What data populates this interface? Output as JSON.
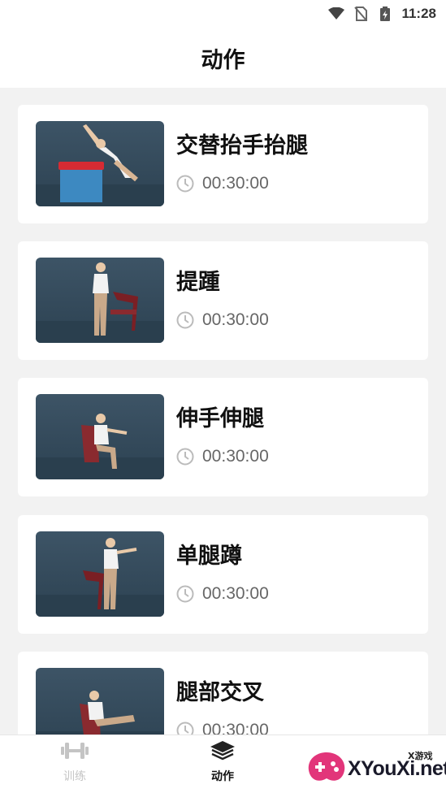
{
  "status_bar": {
    "time": "11:28",
    "icons": [
      "wifi-icon",
      "no-sim-icon",
      "battery-charging-icon"
    ]
  },
  "header": {
    "title": "动作"
  },
  "exercises": [
    {
      "title": "交替抬手抬腿",
      "duration": "00:30:00",
      "icon": "clock-icon"
    },
    {
      "title": "提踵",
      "duration": "00:30:00",
      "icon": "clock-icon"
    },
    {
      "title": "伸手伸腿",
      "duration": "00:30:00",
      "icon": "clock-icon"
    },
    {
      "title": "单腿蹲",
      "duration": "00:30:00",
      "icon": "clock-icon"
    },
    {
      "title": "腿部交叉",
      "duration": "00:30:00",
      "icon": "clock-icon"
    }
  ],
  "tabbar": {
    "tabs": [
      {
        "label": "训练",
        "icon": "dumbbell-icon",
        "active": false
      },
      {
        "label": "动作",
        "icon": "layers-icon",
        "active": true
      }
    ]
  },
  "watermark": {
    "text": "XYouXi.net",
    "sub": "X游戏"
  },
  "colors": {
    "background": "#f2f2f2",
    "card": "#ffffff",
    "muted": "#666666",
    "inactive_tab": "#c4c4c4"
  }
}
